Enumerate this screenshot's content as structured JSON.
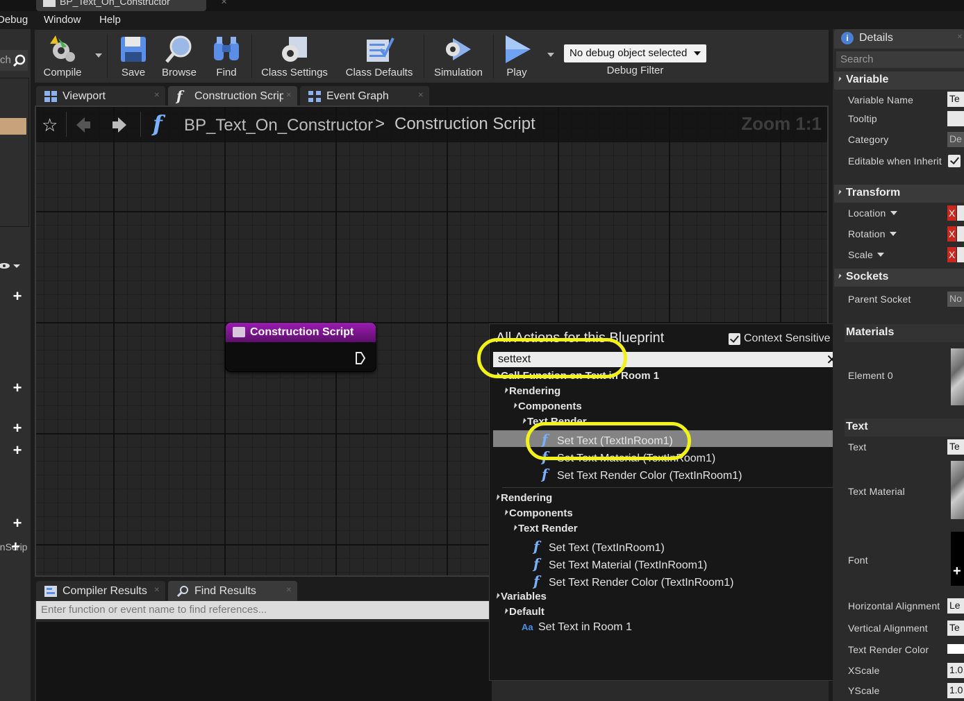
{
  "window": {
    "tab_title": "BP_Text_On_Constructor"
  },
  "menu": {
    "items": [
      "Debug",
      "Window",
      "Help"
    ]
  },
  "toolbar": {
    "compile": "Compile",
    "save": "Save",
    "browse": "Browse",
    "find": "Find",
    "class_settings": "Class Settings",
    "class_defaults": "Class Defaults",
    "simulation": "Simulation",
    "play": "Play",
    "debug_object": "No debug object selected",
    "debug_filter": "Debug Filter"
  },
  "left_panel": {
    "search_fragment": "ch",
    "bottom_label": "onScrip"
  },
  "doc_tabs": [
    {
      "label": "Viewport"
    },
    {
      "label": "Construction Scrip"
    },
    {
      "label": "Event Graph"
    }
  ],
  "breadcrumb": {
    "blueprint": "BP_Text_On_Constructor",
    "separator": ">",
    "graph": "Construction Script",
    "zoom": "Zoom 1:1"
  },
  "node": {
    "title": "Construction Script"
  },
  "bottom_tabs": [
    {
      "label": "Compiler Results"
    },
    {
      "label": "Find Results"
    }
  ],
  "find_placeholder": "Enter function or event name to find references...",
  "action_menu": {
    "title": "All Actions for this Blueprint",
    "context_sensitive": "Context Sensitive",
    "search_value": "settext",
    "rows": [
      {
        "label": "Call Function on Text in Room 1",
        "kind": "cat"
      },
      {
        "label": "Rendering",
        "kind": "cat"
      },
      {
        "label": "Components",
        "kind": "cat"
      },
      {
        "label": "Text Render",
        "kind": "cat"
      },
      {
        "label": "Set Text (TextInRoom1)",
        "kind": "fn",
        "selected": true
      },
      {
        "label": "Set Text Material (TextInRoom1)",
        "kind": "fn"
      },
      {
        "label": "Set Text Render Color (TextInRoom1)",
        "kind": "fn"
      },
      {
        "label": "Rendering",
        "kind": "cat"
      },
      {
        "label": "Components",
        "kind": "cat"
      },
      {
        "label": "Text Render",
        "kind": "cat"
      },
      {
        "label": "Set Text (TextInRoom1)",
        "kind": "fn"
      },
      {
        "label": "Set Text Material (TextInRoom1)",
        "kind": "fn"
      },
      {
        "label": "Set Text Render Color (TextInRoom1)",
        "kind": "fn"
      },
      {
        "label": "Variables",
        "kind": "cat"
      },
      {
        "label": "Default",
        "kind": "cat"
      },
      {
        "label": "Set Text in Room 1",
        "kind": "var"
      }
    ]
  },
  "details": {
    "title": "Details",
    "search_placeholder": "Search",
    "sections": {
      "variable": "Variable",
      "transform": "Transform",
      "sockets": "Sockets",
      "materials": "Materials",
      "text": "Text"
    },
    "props": {
      "variable_name": "Variable Name",
      "variable_name_val": "Te",
      "tooltip": "Tooltip",
      "category": "Category",
      "category_val": "De",
      "editable": "Editable when Inherit",
      "location": "Location",
      "rotation": "Rotation",
      "scale": "Scale",
      "parent_socket": "Parent Socket",
      "parent_socket_val": "No",
      "element0": "Element 0",
      "text": "Text",
      "text_val": "Te",
      "text_material": "Text Material",
      "font": "Font",
      "h_align": "Horizontal Alignment",
      "h_align_val": "Le",
      "v_align": "Vertical Alignment",
      "v_align_val": "Te",
      "render_color": "Text Render Color",
      "xscale": "XScale",
      "xscale_val": "1.0",
      "yscale": "YScale",
      "yscale_val": "1.0"
    },
    "x_badge": "X"
  },
  "colors": {
    "node_header": "#9a1bb0",
    "highlight_ring": "#f2f21a",
    "function_icon": "#7ab0ff",
    "reset_badge": "#c8281e"
  }
}
